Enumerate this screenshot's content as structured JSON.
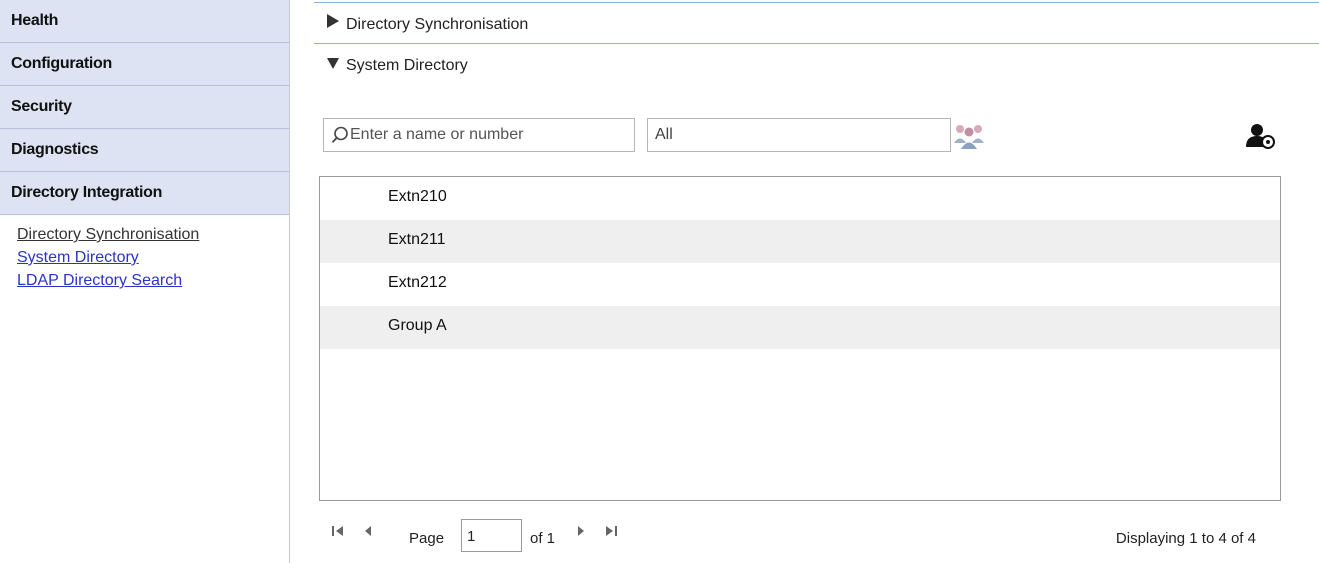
{
  "sidebar": {
    "sections": [
      {
        "label": "Health"
      },
      {
        "label": "Configuration"
      },
      {
        "label": "Security"
      },
      {
        "label": "Diagnostics"
      },
      {
        "label": "Directory Integration"
      }
    ],
    "links": [
      {
        "label": "Directory Synchronisation"
      },
      {
        "label": "System Directory"
      },
      {
        "label": "LDAP Directory Search"
      }
    ]
  },
  "main": {
    "accordions": [
      {
        "label": "Directory Synchronisation",
        "state": "collapsed",
        "icon": "triangle-right-icon"
      },
      {
        "label": "System Directory",
        "state": "expanded",
        "icon": "triangle-down-icon"
      }
    ],
    "search": {
      "placeholder": "Enter a name or number",
      "icon": "search-icon"
    },
    "filter": {
      "value": "All"
    },
    "icons": {
      "group": "group-icon",
      "user_settings": "user-settings-icon"
    },
    "list": {
      "rows": [
        {
          "name": "Extn210"
        },
        {
          "name": "Extn211"
        },
        {
          "name": "Extn212"
        },
        {
          "name": "Group A"
        }
      ]
    },
    "pager": {
      "page_label": "Page",
      "page_value": "1",
      "of_label": "of 1",
      "displaying": "Displaying 1 to 4 of 4"
    }
  }
}
